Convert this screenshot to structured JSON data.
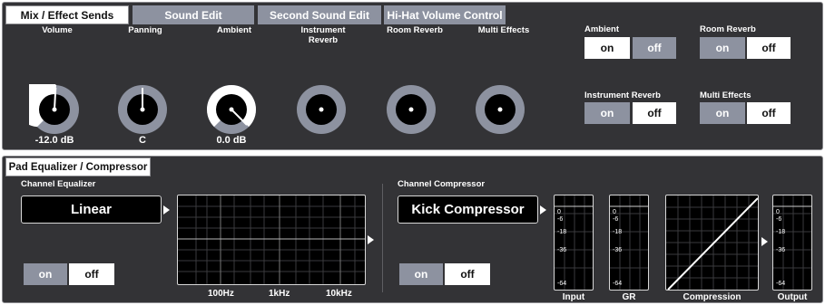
{
  "tabs": {
    "mix": "Mix / Effect Sends",
    "sound_edit": "Sound Edit",
    "second_sound_edit": "Second Sound Edit",
    "hihat": "Hi-Hat Volume Control"
  },
  "knobs": [
    {
      "label": "Volume",
      "value": "-12.0 dB"
    },
    {
      "label": "Panning",
      "value": "C"
    },
    {
      "label": "Ambient",
      "value": "0.0 dB"
    },
    {
      "label": "Instrument Reverb",
      "value": ""
    },
    {
      "label": "Room Reverb",
      "value": ""
    },
    {
      "label": "Multi Effects",
      "value": ""
    }
  ],
  "toggles": {
    "ambient": {
      "label": "Ambient",
      "on": "on",
      "off": "off",
      "selected": "on"
    },
    "room_reverb": {
      "label": "Room Reverb",
      "on": "on",
      "off": "off",
      "selected": "on"
    },
    "instrument_reverb": {
      "label": "Instrument Reverb",
      "on": "on",
      "off": "off",
      "selected": "on"
    },
    "multi_effects": {
      "label": "Multi Effects",
      "on": "on",
      "off": "off",
      "selected": "on"
    }
  },
  "pad_section": {
    "title": "Pad Equalizer / Compressor",
    "equalizer": {
      "label": "Channel Equalizer",
      "mode": "Linear",
      "on": "on",
      "off": "off",
      "freq_labels": [
        "100Hz",
        "1kHz",
        "10kHz"
      ]
    },
    "compressor": {
      "label": "Channel Compressor",
      "preset": "Kick Compressor",
      "on": "on",
      "off": "off",
      "meter_scale": [
        "0",
        "-6",
        "-18",
        "-36",
        "-64"
      ],
      "captions": {
        "input": "Input",
        "gr": "GR",
        "compression": "Compression",
        "output": "Output"
      }
    }
  },
  "colors": {
    "panel": "#333336",
    "selected": "#8d92a0",
    "accent": "#ffffff"
  }
}
